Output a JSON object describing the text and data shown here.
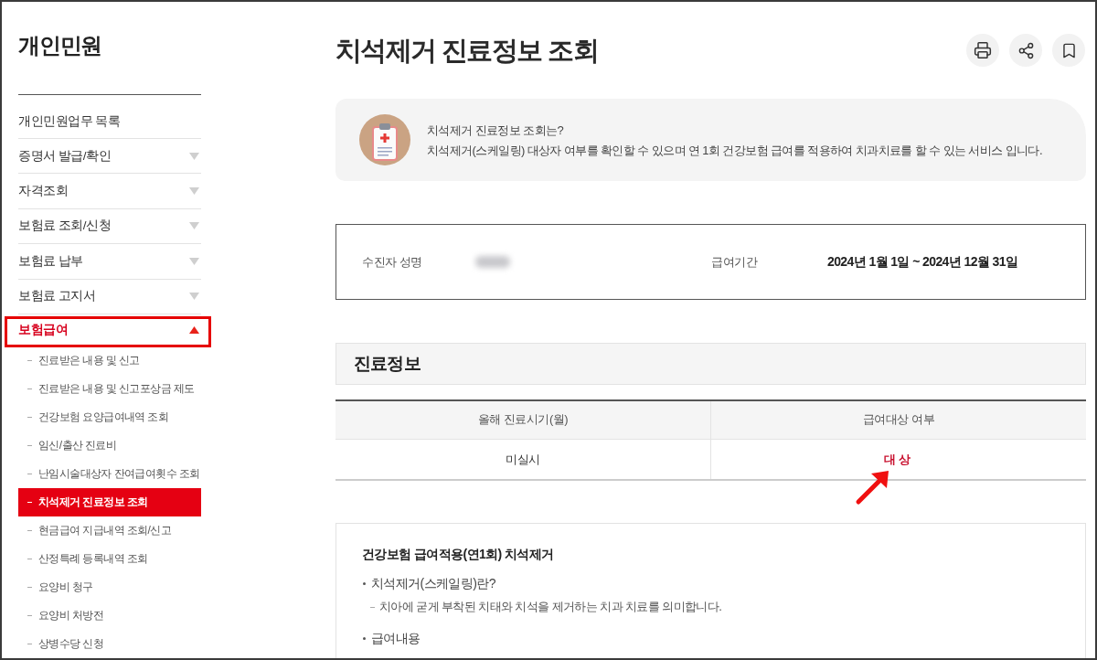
{
  "sidebar": {
    "title": "개인민원",
    "items": [
      {
        "kind": "link",
        "label": "개인민원업무 목록",
        "highlighted": false
      },
      {
        "kind": "group",
        "label": "증명서 발급/확인",
        "expanded": false,
        "highlighted": false
      },
      {
        "kind": "group",
        "label": "자격조회",
        "expanded": false,
        "highlighted": false
      },
      {
        "kind": "group",
        "label": "보험료 조회/신청",
        "expanded": false,
        "highlighted": false
      },
      {
        "kind": "group",
        "label": "보험료 납부",
        "expanded": false,
        "highlighted": false
      },
      {
        "kind": "group",
        "label": "보험료 고지서",
        "expanded": false,
        "highlighted": false
      },
      {
        "kind": "group",
        "label": "보험급여",
        "expanded": true,
        "highlighted": true,
        "children": [
          {
            "label": "진료받은 내용 및 신고",
            "selected": false
          },
          {
            "label": "진료받은 내용 및 신고포상금 제도",
            "selected": false
          },
          {
            "label": "건강보험 요양급여내역 조회",
            "selected": false
          },
          {
            "label": "임신/출산 진료비",
            "selected": false
          },
          {
            "label": "난임시술대상자 잔여급여횟수 조회",
            "selected": false
          },
          {
            "label": "치석제거 진료정보 조회",
            "selected": true
          },
          {
            "label": "현금급여 지급내역 조회/신고",
            "selected": false
          },
          {
            "label": "산정특례 등록내역 조회",
            "selected": false
          },
          {
            "label": "요양비 청구",
            "selected": false
          },
          {
            "label": "요양비 처방전",
            "selected": false
          },
          {
            "label": "상병수당 신청",
            "selected": false
          }
        ]
      }
    ]
  },
  "page": {
    "title": "치석제거 진료정보 조회"
  },
  "intro": {
    "heading": "치석제거 진료정보 조회는?",
    "text": "치석제거(스케일링) 대상자 여부를 확인할 수 있으며 연 1회 건강보험 급여를 적용하여 치과치료를 할 수 있는 서비스 입니다."
  },
  "recipient": {
    "fields": [
      {
        "kind": "redacted",
        "label": "수진자 성명"
      },
      {
        "kind": "text",
        "label": "급여기간",
        "value": "2024년 1월 1일 ~ 2024년 12월 31일"
      }
    ]
  },
  "treatment_info": {
    "title": "진료정보",
    "columns": [
      "올해 진료시기(월)",
      "급여대상 여부"
    ],
    "rows": [
      {
        "cells": [
          {
            "text": "미실시",
            "emphasis": false,
            "arrow": false
          },
          {
            "text": "대상",
            "emphasis": true,
            "arrow": true
          }
        ]
      }
    ]
  },
  "guide": {
    "title": "건강보험 급여적용(연1회) 치석제거",
    "items": [
      {
        "text": "치석제거(스케일링)란?",
        "children": [
          {
            "text": "치아에 굳게 부착된 치태와 치석을 제거하는 치과 치료를 의미합니다."
          }
        ]
      },
      {
        "text": "급여내용"
      }
    ]
  }
}
